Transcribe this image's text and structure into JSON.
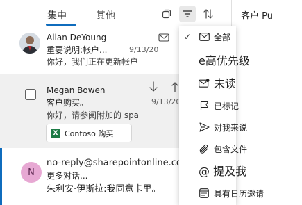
{
  "header": {
    "tabs": [
      {
        "label": "集中",
        "selected": true
      },
      {
        "label": "其他",
        "selected": false
      }
    ],
    "right_title": "客户 Pu"
  },
  "messages": [
    {
      "sender": "Allan DeYoung",
      "subject": "重要说明:帐户...",
      "date": "9/13/20",
      "preview": "你好，我们正在更新帐户",
      "avatar": "photo"
    },
    {
      "sender": "Megan Bowen",
      "subject": "客户购买。",
      "date": "9/13/20",
      "preview": "你好，请参阅附加的 spa",
      "attachment": "Contoso 购买",
      "attachment_icon": "excel-icon"
    },
    {
      "sender": "no-reply@sharepointonline.com",
      "subject": "更多对话...",
      "preview": "朱利安·伊斯拉:我同意卡里。",
      "avatar_initial": "N",
      "avatar_color": "#e7a8d3"
    }
  ],
  "filter_menu": {
    "items": [
      {
        "label": "全部",
        "icon": "mail-icon",
        "checked": true
      },
      {
        "label": "e高优先级",
        "icon": "",
        "checked": false
      },
      {
        "label": "未读",
        "icon": "mail-unread-icon",
        "checked": false
      },
      {
        "label": "已标记",
        "icon": "flag-icon",
        "checked": false
      },
      {
        "label": "对我来说",
        "icon": "send-icon",
        "checked": false
      },
      {
        "label": "包含文件",
        "icon": "paperclip-icon",
        "checked": false
      },
      {
        "label": "@ 提及我",
        "icon": "",
        "checked": false
      },
      {
        "label": "具有日历邀请",
        "icon": "calendar-icon",
        "checked": false
      }
    ]
  },
  "colors": {
    "accent": "#0f6cbd",
    "selected_row": "#f0f0f0",
    "excel": "#1d7b45"
  }
}
